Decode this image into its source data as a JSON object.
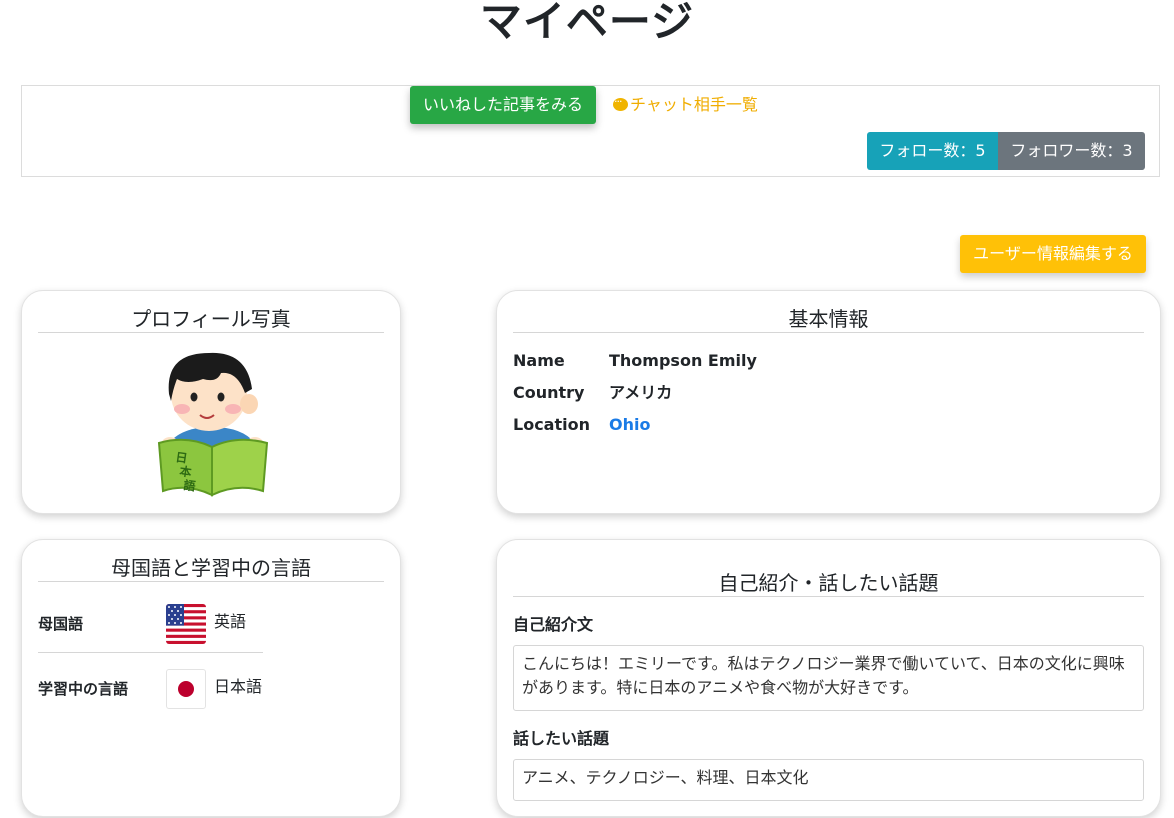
{
  "page": {
    "title": "マイページ"
  },
  "actions": {
    "liked_articles": "いいねした記事をみる",
    "chat_list": "チャット相手一覧",
    "follow_count": "フォロー数：5",
    "follower_count": "フォロワー数：3",
    "edit_user": "ユーザー情報編集する"
  },
  "profile_photo": {
    "title": "プロフィール写真",
    "image_text": "日本語"
  },
  "basic_info": {
    "title": "基本情報",
    "name_label": "Name",
    "name_value": "Thompson Emily",
    "country_label": "Country",
    "country_value": "アメリカ",
    "location_label": "Location",
    "location_value": "Ohio"
  },
  "languages": {
    "title": "母国語と学習中の言語",
    "native_label": "母国語",
    "native_value": "英語",
    "learning_label": "学習中の言語",
    "learning_value": "日本語"
  },
  "intro": {
    "title": "自己紹介・話したい話題",
    "intro_label": "自己紹介文",
    "intro_text": "こんにちは！エミリーです。私はテクノロジー業界で働いていて、日本の文化に興味があります。特に日本のアニメや食べ物が大好きです。",
    "topics_label": "話したい話題",
    "topics_text": "アニメ、テクノロジー、料理、日本文化"
  },
  "colors": {
    "success": "#28a745",
    "info": "#17a2b8",
    "secondary": "#6c757d",
    "warning": "#ffc107",
    "link": "#1a7be6"
  }
}
